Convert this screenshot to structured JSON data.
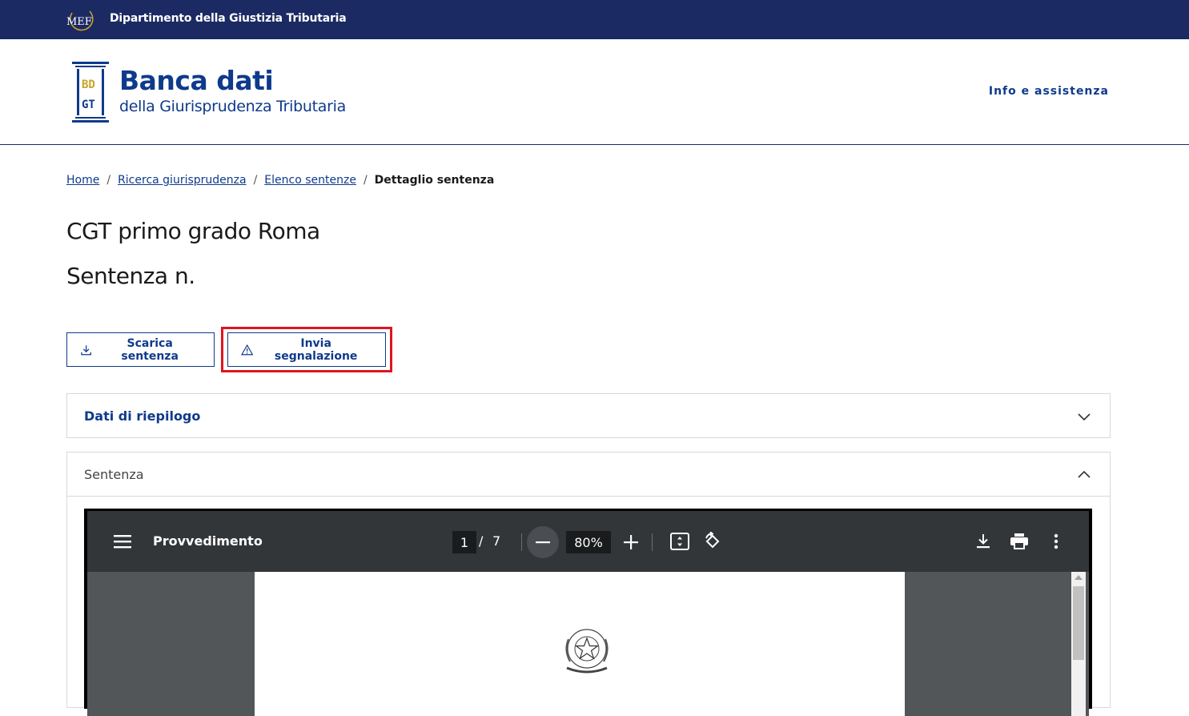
{
  "topbar": {
    "logo_text": "MEF",
    "title": "Dipartimento della Giustizia Tributaria"
  },
  "header": {
    "logo_letters": [
      "BD",
      "GT"
    ],
    "brand_title": "Banca dati",
    "brand_subtitle": "della Giurisprudenza Tributaria",
    "info_link": "Info e assistenza"
  },
  "breadcrumb": {
    "items": [
      {
        "label": "Home"
      },
      {
        "label": "Ricerca giurisprudenza"
      },
      {
        "label": "Elenco sentenze"
      }
    ],
    "separator": "/",
    "current": "Dettaglio sentenza"
  },
  "page": {
    "title": "CGT primo grado Roma",
    "subtitle": "Sentenza n."
  },
  "actions": {
    "download_label": "Scarica sentenza",
    "report_label": "Invia segnalazione"
  },
  "accordions": [
    {
      "title": "Dati di riepilogo",
      "expanded": false
    },
    {
      "title": "Sentenza",
      "expanded": true
    }
  ],
  "viewer": {
    "title": "Provvedimento",
    "current_page": "1",
    "page_separator": "/",
    "total_pages": "7",
    "zoom": "80%",
    "icons": [
      "menu-icon",
      "zoom-out-icon",
      "zoom-in-icon",
      "fit-page-icon",
      "rotate-icon",
      "download-icon",
      "print-icon",
      "more-icon"
    ]
  },
  "colors": {
    "navy": "#1b2a63",
    "brand_blue": "#0e3a8c",
    "gold": "#c9a227",
    "highlight_red": "#e0141e",
    "viewer_toolbar": "#333639",
    "viewer_bg": "#525659"
  }
}
